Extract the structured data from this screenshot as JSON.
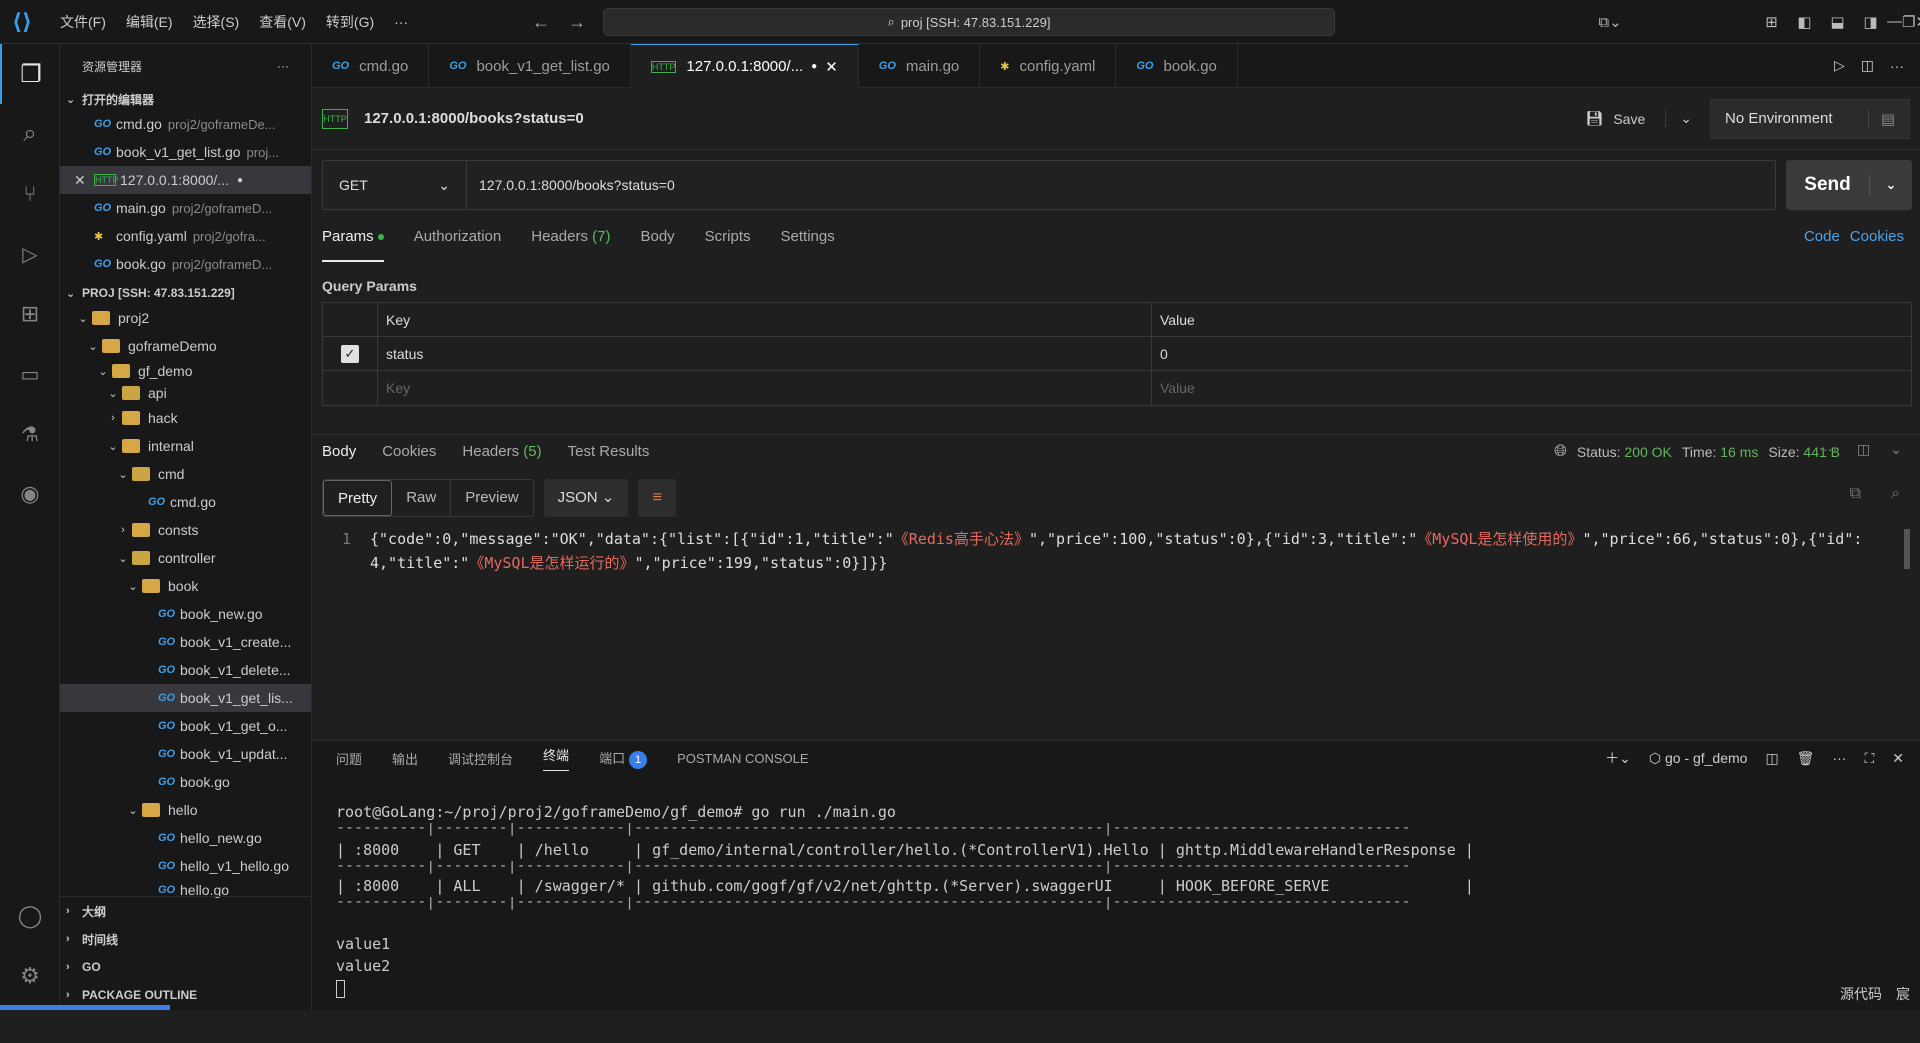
{
  "menu": [
    "文件(F)",
    "编辑(E)",
    "选择(S)",
    "查看(V)",
    "转到(G)",
    "···"
  ],
  "command_center": "proj [SSH: 47.83.151.229]",
  "sidebar": {
    "title": "资源管理器",
    "open_editors_label": "打开的编辑器",
    "open_editors": [
      {
        "name": "cmd.go",
        "path": "proj2/goframeDe...",
        "icon": "go"
      },
      {
        "name": "book_v1_get_list.go",
        "path": "proj...",
        "icon": "go"
      },
      {
        "name": "127.0.0.1:8000/...",
        "path": "",
        "icon": "http"
      },
      {
        "name": "main.go",
        "path": "proj2/goframeD...",
        "icon": "go"
      },
      {
        "name": "config.yaml",
        "path": "proj2/gofra...",
        "icon": "yaml"
      },
      {
        "name": "book.go",
        "path": "proj2/goframeD...",
        "icon": "go"
      }
    ],
    "project_label": "PROJ [SSH: 47.83.151.229]",
    "tree": [
      "proj2",
      "goframeDemo",
      "gf_demo",
      "api",
      "hack",
      "internal",
      "cmd",
      "cmd.go",
      "consts",
      "controller",
      "book",
      "book_new.go",
      "book_v1_create...",
      "book_v1_delete...",
      "book_v1_get_lis...",
      "book_v1_get_o...",
      "book_v1_updat...",
      "book.go",
      "hello",
      "hello_new.go",
      "hello_v1_hello.go",
      "hello.go"
    ],
    "bottom_sections": [
      "大纲",
      "时间线",
      "GO",
      "PACKAGE OUTLINE"
    ]
  },
  "tabs": [
    {
      "label": "cmd.go",
      "icon": "go"
    },
    {
      "label": "book_v1_get_list.go",
      "icon": "go"
    },
    {
      "label": "127.0.0.1:8000/...",
      "icon": "http"
    },
    {
      "label": "main.go",
      "icon": "go"
    },
    {
      "label": "config.yaml",
      "icon": "yaml"
    },
    {
      "label": "book.go",
      "icon": "go"
    }
  ],
  "request": {
    "title": "127.0.0.1:8000/books?status=0",
    "save_label": "Save",
    "environment": "No Environment",
    "method": "GET",
    "url": "127.0.0.1:8000/books?status=0",
    "send_label": "Send",
    "tabs": [
      "Params",
      "Authorization",
      "Headers",
      "Body",
      "Scripts",
      "Settings"
    ],
    "headers_count": "(7)",
    "links": [
      "Code",
      "Cookies"
    ],
    "query_params_label": "Query Params",
    "table_headers": [
      "Key",
      "Value"
    ],
    "params": [
      {
        "key": "status",
        "value": "0",
        "checked": true
      }
    ],
    "key_placeholder": "Key",
    "value_placeholder": "Value"
  },
  "response": {
    "tabs": [
      "Body",
      "Cookies",
      "Headers",
      "Test Results"
    ],
    "headers_count": "(5)",
    "status_label": "Status:",
    "status_value": "200 OK",
    "time_label": "Time:",
    "time_value": "16 ms",
    "size_label": "Size:",
    "size_value": "441 B",
    "view_modes": [
      "Pretty",
      "Raw",
      "Preview"
    ],
    "format": "JSON",
    "line_number": "1",
    "body": "{\"code\":0,\"message\":\"OK\",\"data\":{\"list\":[{\"id\":1,\"title\":\"《Redis高手心法》\",\"price\":100,\"status\":0},{\"id\":3,\"title\":\"《MySQL是怎样使用的》\",\"price\":66,\"status\":0},{\"id\":4,\"title\":\"《MySQL是怎样运行的》\",\"price\":199,\"status\":0}]}}"
  },
  "panel": {
    "tabs": [
      "问题",
      "输出",
      "调试控制台",
      "终端",
      "端口",
      "POSTMAN CONSOLE"
    ],
    "ports_badge": "1",
    "terminal_name": "go - gf_demo",
    "terminal_lines": [
      "root@GoLang:~/proj/proj2/goframeDemo/gf_demo# go run ./main.go",
      "----------|--------|------------|----------------------------------------------------|---------------------------------",
      "| :8000    | GET    | /hello     | gf_demo/internal/controller/hello.(*ControllerV1).Hello | ghttp.MiddlewareHandlerResponse |",
      "----------|--------|------------|----------------------------------------------------|---------------------------------",
      "| :8000    | ALL    | /swagger/* | github.com/gogf/gf/v2/net/ghttp.(*Server).swaggerUI     | HOOK_BEFORE_SERVE               |",
      "----------|--------|------------|----------------------------------------------------|---------------------------------",
      "",
      "value1",
      "value2"
    ]
  },
  "statusbar": [
    "源代码",
    "宸"
  ],
  "colors": {
    "accent": "#3b9ee8",
    "status_ok": "#5fb65f",
    "json_string": "#e36a5e"
  }
}
